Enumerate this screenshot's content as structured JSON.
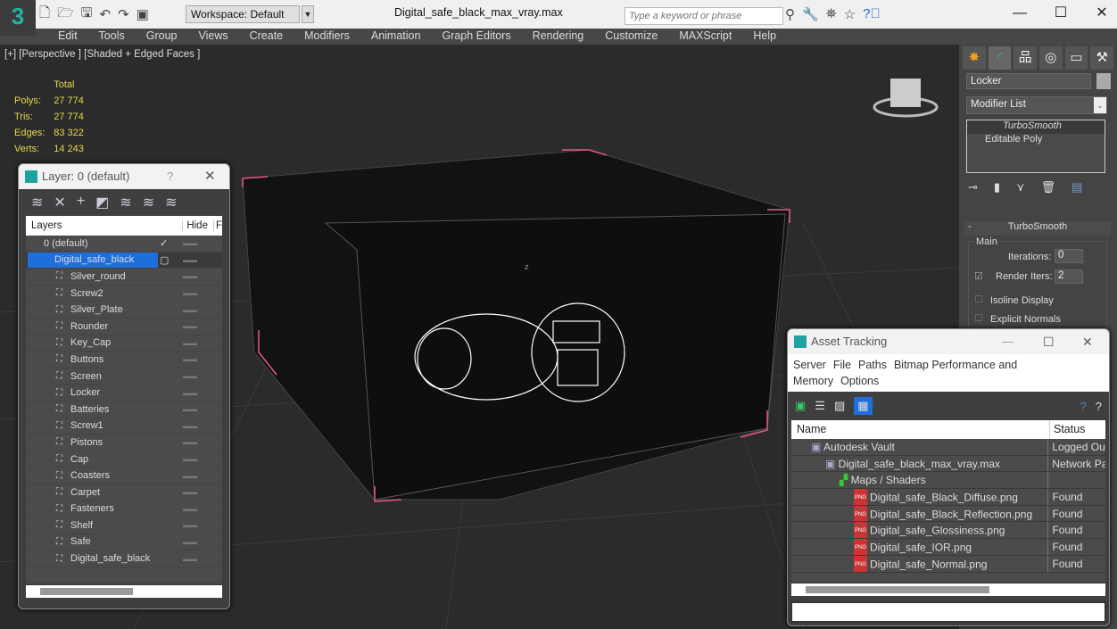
{
  "app": {
    "title": "Digital_safe_black_max_vray.max",
    "workspace": "Workspace: Default",
    "search_placeholder": "Type a keyword or phrase"
  },
  "menu": [
    "Edit",
    "Tools",
    "Group",
    "Views",
    "Create",
    "Modifiers",
    "Animation",
    "Graph Editors",
    "Rendering",
    "Customize",
    "MAXScript",
    "Help"
  ],
  "viewport": {
    "label": "[+] [Perspective ] [Shaded + Edged Faces ]",
    "stats": {
      "header": "Total",
      "rows": [
        [
          "Polys:",
          "27 774"
        ],
        [
          "Tris:",
          "27 774"
        ],
        [
          "Edges:",
          "83 322"
        ],
        [
          "Verts:",
          "14 243"
        ]
      ]
    },
    "axis": "z"
  },
  "command_panel": {
    "object_name": "Locker",
    "modifier_list": "Modifier List",
    "stack": [
      "TurboSmooth",
      "Editable Poly"
    ],
    "rollout": "TurboSmooth",
    "group": "Main",
    "iterations_label": "Iterations:",
    "iterations": "0",
    "render_iters_label": "Render Iters:",
    "render_iters": "2",
    "render_iters_checked": true,
    "isoline": "Isoline Display",
    "explicit_normals": "Explicit Normals"
  },
  "layer_dialog": {
    "title": "Layer: 0 (default)",
    "help": "?",
    "col_layers": "Layers",
    "col_hide": "Hide",
    "col_f": "F",
    "default_layer": "0 (default)",
    "selected_layer": "Digital_safe_black",
    "objects": [
      "Silver_round",
      "Screw2",
      "Silver_Plate",
      "Rounder",
      "Key_Cap",
      "Buttons",
      "Screen",
      "Locker",
      "Batteries",
      "Screw1",
      "Pistons",
      "Cap",
      "Coasters",
      "Carpet",
      "Fasteners",
      "Shelf",
      "Safe",
      "Digital_safe_black"
    ]
  },
  "asset_tracking": {
    "title": "Asset Tracking",
    "menu": [
      "Server",
      "File",
      "Paths",
      "Bitmap Performance and Memory",
      "Options"
    ],
    "col_name": "Name",
    "col_status": "Status",
    "rows": [
      {
        "name": "Autodesk Vault",
        "status": "Logged Out",
        "indent": 1
      },
      {
        "name": "Digital_safe_black_max_vray.max",
        "status": "Network Path",
        "indent": 2
      },
      {
        "name": "Maps / Shaders",
        "status": "",
        "indent": 3
      },
      {
        "name": "Digital_safe_Black_Diffuse.png",
        "status": "Found",
        "indent": 4
      },
      {
        "name": "Digital_safe_Black_Reflection.png",
        "status": "Found",
        "indent": 4
      },
      {
        "name": "Digital_safe_Glossiness.png",
        "status": "Found",
        "indent": 4
      },
      {
        "name": "Digital_safe_IOR.png",
        "status": "Found",
        "indent": 4
      },
      {
        "name": "Digital_safe_Normal.png",
        "status": "Found",
        "indent": 4
      }
    ]
  },
  "colors": {
    "accent": "#1e6fd9",
    "stats": "#e8d84a",
    "selection": "#e05a8a"
  }
}
